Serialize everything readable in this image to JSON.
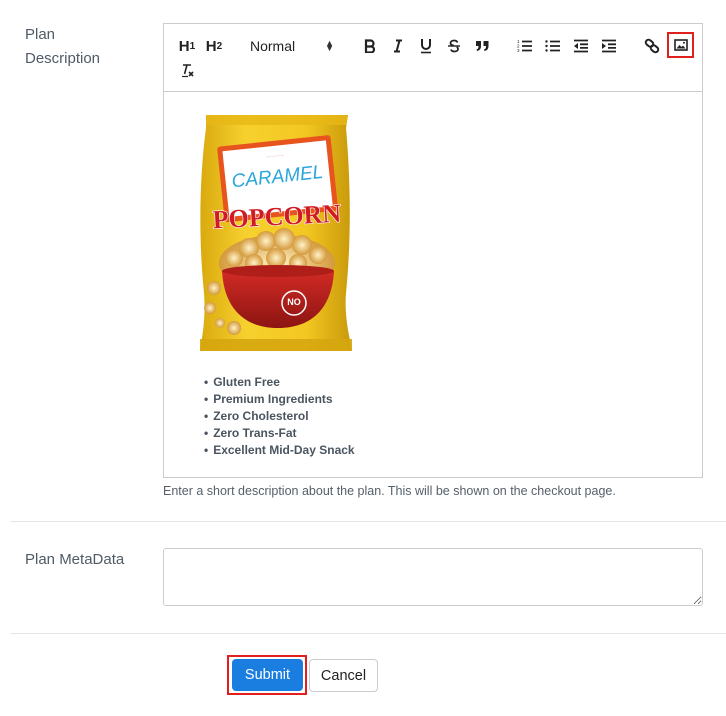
{
  "form": {
    "description_label_line1": "Plan",
    "description_label_line2": "Description",
    "metadata_label": "Plan MetaData",
    "description_help": "Enter a short description about the plan. This will be shown on the checkout page.",
    "metadata_value": ""
  },
  "toolbar": {
    "h1": "H",
    "h1_sub": "1",
    "h2": "H",
    "h2_sub": "2",
    "format_picker_value": "Normal",
    "buttons": [
      {
        "name": "bold",
        "icon": "bold-icon"
      },
      {
        "name": "italic",
        "icon": "italic-icon"
      },
      {
        "name": "underline",
        "icon": "underline-icon"
      },
      {
        "name": "strikethrough",
        "icon": "strikethrough-icon"
      },
      {
        "name": "blockquote",
        "icon": "quote-icon"
      },
      {
        "name": "ordered-list",
        "icon": "ordered-list-icon"
      },
      {
        "name": "bullet-list",
        "icon": "bullet-list-icon"
      },
      {
        "name": "outdent",
        "icon": "outdent-icon"
      },
      {
        "name": "indent",
        "icon": "indent-icon"
      },
      {
        "name": "link",
        "icon": "link-icon"
      },
      {
        "name": "image",
        "icon": "image-icon",
        "highlighted": true
      },
      {
        "name": "clean",
        "icon": "clear-format-icon"
      }
    ]
  },
  "editor_content": {
    "image": {
      "alt": "Caramel Popcorn bag",
      "title_line1": "CARAMEL",
      "title_line2": "POPCORN",
      "badge": "NO"
    },
    "bullets": [
      "Gluten Free",
      "Premium Ingredients",
      "Zero Cholesterol",
      "Zero Trans-Fat",
      "Excellent Mid-Day Snack"
    ]
  },
  "actions": {
    "submit_label": "Submit",
    "cancel_label": "Cancel"
  },
  "colors": {
    "primary": "#1a7ee0",
    "highlight": "#e0201c"
  }
}
